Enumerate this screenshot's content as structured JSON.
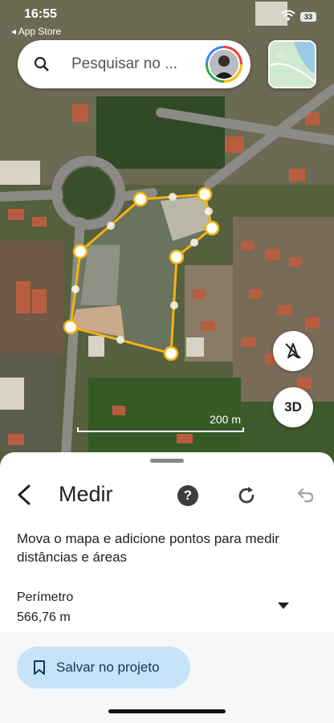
{
  "status_bar": {
    "time": "16:55",
    "back_label": "◂ App Store",
    "battery": "33"
  },
  "search": {
    "placeholder": "Pesquisar no ..."
  },
  "map": {
    "scale_label": "200 m",
    "button_3d": "3D"
  },
  "colors": {
    "measure_line": "#f2b311",
    "save_button_bg": "#c7e3f8",
    "accent_text": "#0b3a5c"
  },
  "icons": [
    "search-icon",
    "avatar",
    "minimap",
    "compass-off-icon",
    "back-arrow-icon",
    "help-icon",
    "redo-icon",
    "undo-icon",
    "chevron-down-icon",
    "bookmark-icon"
  ],
  "sheet": {
    "title": "Medir",
    "help": "?",
    "description": "Mova o mapa e adicione pontos para medir distâncias e áreas",
    "perimeter_label": "Perímetro",
    "perimeter_value": "566,76 m",
    "save_label": "Salvar no projeto"
  }
}
